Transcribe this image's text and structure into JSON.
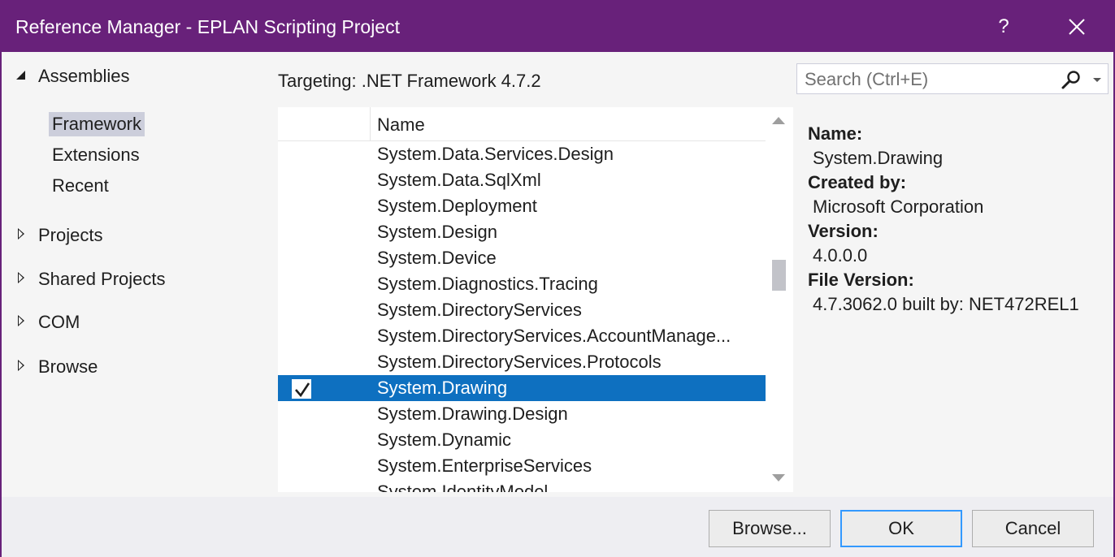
{
  "window": {
    "title": "Reference Manager - EPLAN Scripting Project",
    "help_label": "?",
    "close_icon": "close-icon"
  },
  "nav": {
    "assemblies_label": "Assemblies",
    "assemblies_items": [
      {
        "label": "Framework",
        "selected": true
      },
      {
        "label": "Extensions",
        "selected": false
      },
      {
        "label": "Recent",
        "selected": false
      }
    ],
    "sections": [
      {
        "label": "Projects"
      },
      {
        "label": "Shared Projects"
      },
      {
        "label": "COM"
      },
      {
        "label": "Browse"
      }
    ]
  },
  "main": {
    "targeting": "Targeting: .NET Framework 4.7.2",
    "list": {
      "column_name": "Name",
      "rows": [
        {
          "name": "System.Data.Services.Design",
          "checked": false,
          "selected": false
        },
        {
          "name": "System.Data.SqlXml",
          "checked": false,
          "selected": false
        },
        {
          "name": "System.Deployment",
          "checked": false,
          "selected": false
        },
        {
          "name": "System.Design",
          "checked": false,
          "selected": false
        },
        {
          "name": "System.Device",
          "checked": false,
          "selected": false
        },
        {
          "name": "System.Diagnostics.Tracing",
          "checked": false,
          "selected": false
        },
        {
          "name": "System.DirectoryServices",
          "checked": false,
          "selected": false
        },
        {
          "name": "System.DirectoryServices.AccountManage...",
          "checked": false,
          "selected": false
        },
        {
          "name": "System.DirectoryServices.Protocols",
          "checked": false,
          "selected": false
        },
        {
          "name": "System.Drawing",
          "checked": true,
          "selected": true
        },
        {
          "name": "System.Drawing.Design",
          "checked": false,
          "selected": false
        },
        {
          "name": "System.Dynamic",
          "checked": false,
          "selected": false
        },
        {
          "name": "System.EnterpriseServices",
          "checked": false,
          "selected": false
        },
        {
          "name": "System.IdentityModel",
          "checked": false,
          "selected": false
        }
      ]
    }
  },
  "search": {
    "placeholder": "Search (Ctrl+E)",
    "icon": "search-icon"
  },
  "details": {
    "name_label": "Name:",
    "name_value": "System.Drawing",
    "created_by_label": "Created by:",
    "created_by_value": "Microsoft Corporation",
    "version_label": "Version:",
    "version_value": "4.0.0.0",
    "file_version_label": "File Version:",
    "file_version_value": "4.7.3062.0 built by: NET472REL1"
  },
  "buttons": {
    "browse": "Browse...",
    "ok": "OK",
    "cancel": "Cancel"
  },
  "colors": {
    "title_bar": "#68217a",
    "selection": "#0e70c0",
    "nav_selected": "#cccedb"
  }
}
